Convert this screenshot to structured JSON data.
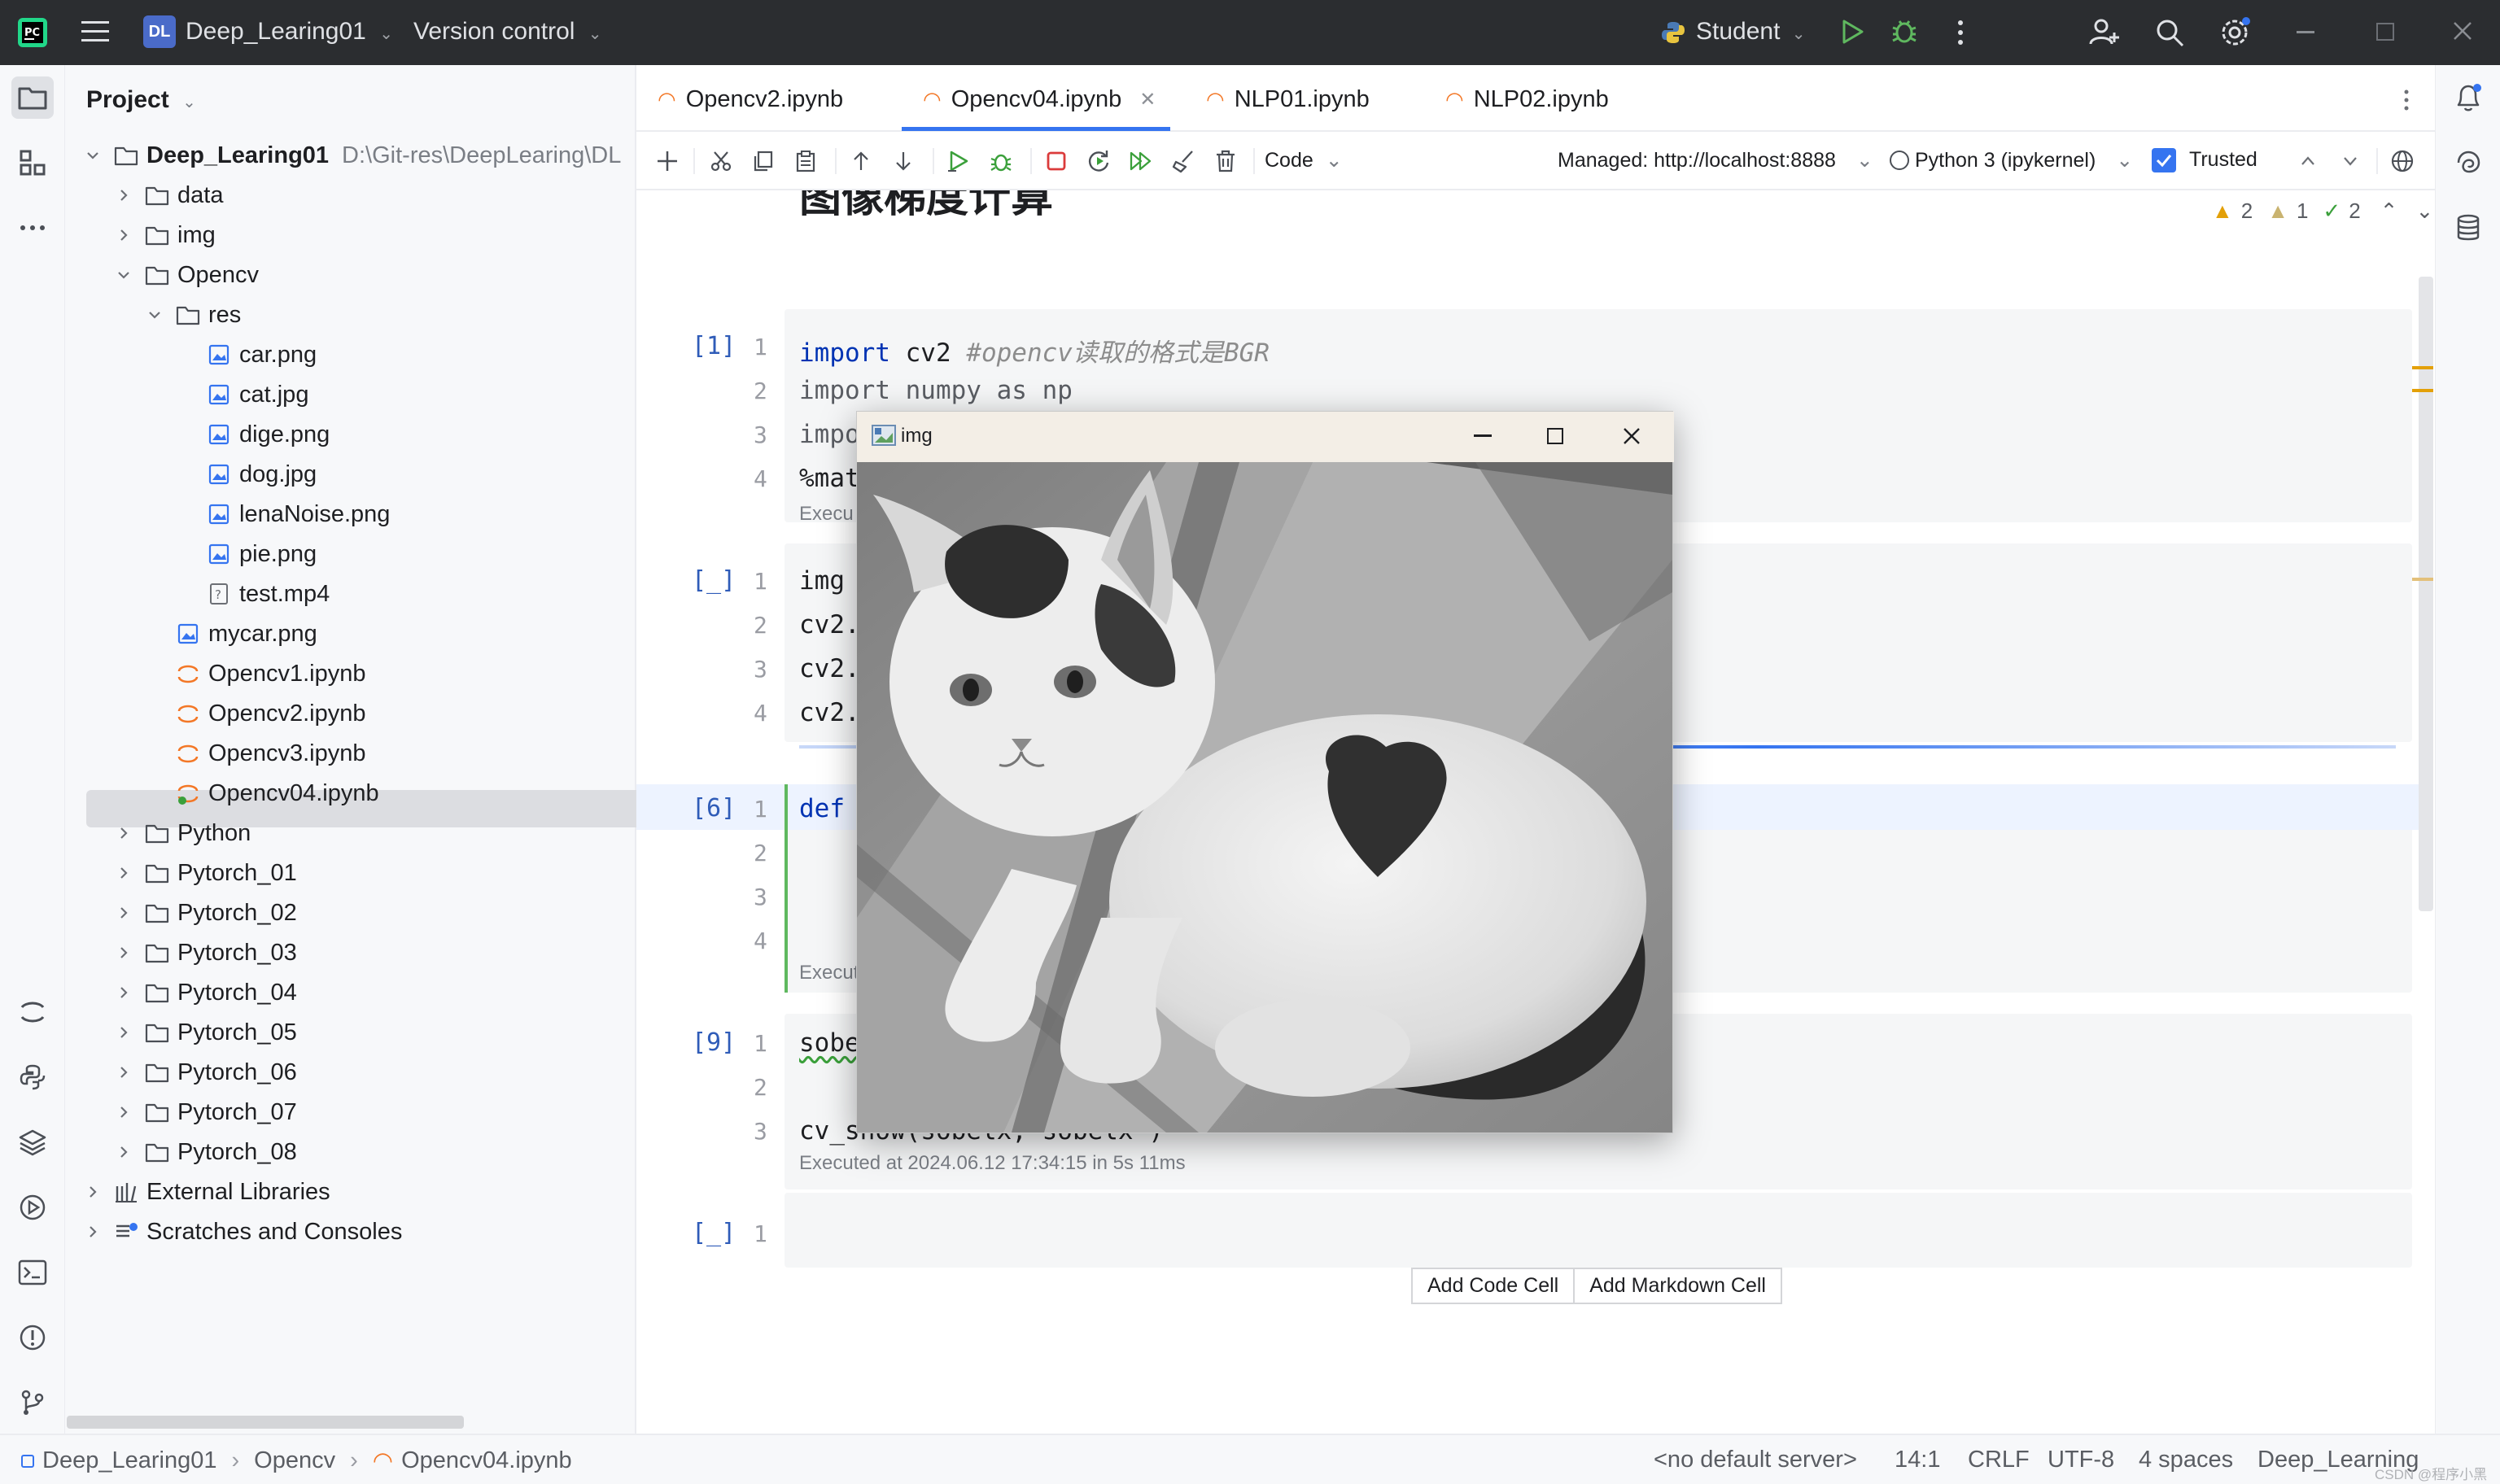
{
  "titlebar": {
    "project_badge": "DL",
    "project_name": "Deep_Learing01",
    "vcs": "Version control",
    "run_config": "Student"
  },
  "project_panel": {
    "title": "Project",
    "root_path": "D:\\Git-res\\DeepLearing\\DL",
    "tree": [
      {
        "label": "Deep_Learing01",
        "kind": "root-folder"
      },
      {
        "label": "data",
        "kind": "folder"
      },
      {
        "label": "img",
        "kind": "folder"
      },
      {
        "label": "Opencv",
        "kind": "folder-open"
      },
      {
        "label": "res",
        "kind": "folder-open"
      },
      {
        "label": "car.png",
        "kind": "image"
      },
      {
        "label": "cat.jpg",
        "kind": "image"
      },
      {
        "label": "dige.png",
        "kind": "image"
      },
      {
        "label": "dog.jpg",
        "kind": "image"
      },
      {
        "label": "lenaNoise.png",
        "kind": "image"
      },
      {
        "label": "pie.png",
        "kind": "image"
      },
      {
        "label": "test.mp4",
        "kind": "unknown"
      },
      {
        "label": "mycar.png",
        "kind": "image"
      },
      {
        "label": "Opencv1.ipynb",
        "kind": "notebook"
      },
      {
        "label": "Opencv2.ipynb",
        "kind": "notebook"
      },
      {
        "label": "Opencv3.ipynb",
        "kind": "notebook"
      },
      {
        "label": "Opencv04.ipynb",
        "kind": "notebook-active"
      },
      {
        "label": "Python",
        "kind": "folder"
      },
      {
        "label": "Pytorch_01",
        "kind": "folder"
      },
      {
        "label": "Pytorch_02",
        "kind": "folder"
      },
      {
        "label": "Pytorch_03",
        "kind": "folder"
      },
      {
        "label": "Pytorch_04",
        "kind": "folder"
      },
      {
        "label": "Pytorch_05",
        "kind": "folder"
      },
      {
        "label": "Pytorch_06",
        "kind": "folder"
      },
      {
        "label": "Pytorch_07",
        "kind": "folder"
      },
      {
        "label": "Pytorch_08",
        "kind": "folder"
      },
      {
        "label": "External Libraries",
        "kind": "library"
      },
      {
        "label": "Scratches and Consoles",
        "kind": "scratch"
      }
    ]
  },
  "tabs": [
    {
      "label": "Opencv2.ipynb",
      "active": false
    },
    {
      "label": "Opencv04.ipynb",
      "active": true
    },
    {
      "label": "NLP01.ipynb",
      "active": false
    },
    {
      "label": "NLP02.ipynb",
      "active": false
    }
  ],
  "toolbar": {
    "cell_type": "Code",
    "server": "Managed: http://localhost:8888",
    "kernel": "Python 3 (ipykernel)",
    "trusted": "Trusted",
    "trusted_checked": true
  },
  "inspections": {
    "warnings": "2",
    "weak_warnings": "1",
    "ok": "2"
  },
  "notebook": {
    "heading_partial": "图像梯度计算",
    "cells": [
      {
        "prompt": "[1]",
        "lines": [
          "import cv2 #opencv读取的格式是BGR",
          "import numpy as np",
          "impo",
          "%mat"
        ],
        "exec": "Execu"
      },
      {
        "prompt": "[_]",
        "lines": [
          "img",
          "cv2.",
          "cv2.",
          "cv2."
        ]
      },
      {
        "prompt": "[6]",
        "lines": [
          "def",
          "",
          "",
          ""
        ],
        "exec": "Execut"
      },
      {
        "prompt": "[9]",
        "lines": [
          "sobe",
          "",
          "cv_show(sobelx,'sobelx')"
        ],
        "exec": "Executed at 2024.06.12 17:34:15 in 5s 11ms"
      },
      {
        "prompt": "[_]",
        "lines": [
          ""
        ]
      }
    ],
    "add_code_cell": "Add Code Cell",
    "add_markdown_cell": "Add Markdown Cell"
  },
  "image_window": {
    "title": "img",
    "content": "grayscale photo of a white kitten with dark patches sitting on pavement"
  },
  "breadcrumb": [
    "Deep_Learing01",
    "Opencv",
    "Opencv04.ipynb"
  ],
  "status": {
    "server": "<no default server>",
    "position": "14:1",
    "line_sep": "CRLF",
    "encoding": "UTF-8",
    "indent": "4 spaces",
    "interpreter": "Deep_Learning",
    "watermark": "CSDN @程序小黑"
  },
  "colors": {
    "accent": "#3574f0",
    "notebook_icon": "#f37726",
    "run_green": "#3ba03b",
    "stop_red": "#db3b3b"
  }
}
